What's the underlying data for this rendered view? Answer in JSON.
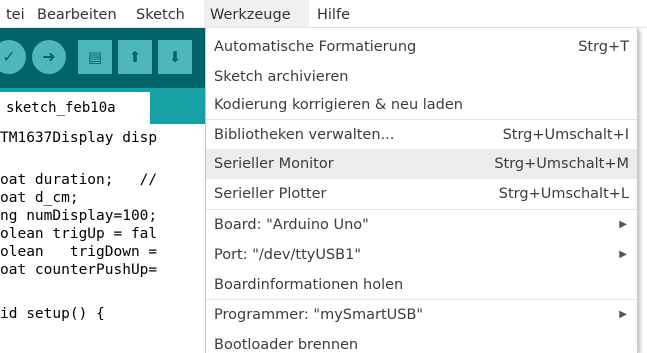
{
  "menubar": {
    "items": [
      {
        "label": "tei"
      },
      {
        "label": "Bearbeiten"
      },
      {
        "label": "Sketch"
      },
      {
        "label": "Werkzeuge"
      },
      {
        "label": "Hilfe"
      }
    ]
  },
  "toolbar": {
    "verify_icon": "verify-icon",
    "upload_icon": "upload-icon",
    "new_icon": "new-icon",
    "open_icon": "open-icon",
    "save_icon": "save-icon"
  },
  "editor": {
    "tab_label": "sketch_feb10a",
    "lines": [
      "TM1637Display disp",
      "",
      "oat duration;   //",
      "oat d_cm;",
      "ng numDisplay=100;",
      "olean trigUp = fal",
      "olean   trigDown =",
      "oat counterPushUp=",
      "",
      "id setup() {"
    ]
  },
  "dropdown": {
    "items": [
      {
        "label": "Automatische Formatierung",
        "shortcut": "Strg+T"
      },
      {
        "label": "Sketch archivieren",
        "shortcut": ""
      },
      {
        "label": "Kodierung korrigieren & neu laden",
        "shortcut": ""
      },
      {
        "label": "Bibliotheken verwalten...",
        "shortcut": "Strg+Umschalt+I"
      },
      {
        "label": "Serieller Monitor",
        "shortcut": "Strg+Umschalt+M"
      },
      {
        "label": "Serieller Plotter",
        "shortcut": "Strg+Umschalt+L"
      },
      {
        "label": "Board: \"Arduino Uno\"",
        "shortcut": ""
      },
      {
        "label": "Port: \"/dev/ttyUSB1\"",
        "shortcut": ""
      },
      {
        "label": "Boardinformationen holen",
        "shortcut": ""
      },
      {
        "label": "Programmer: \"mySmartUSB\"",
        "shortcut": ""
      },
      {
        "label": "Bootloader brennen",
        "shortcut": ""
      }
    ],
    "highlighted_item": "Serieller Monitor"
  },
  "colors": {
    "toolbar_bg": "#006468",
    "tab_strip_bg": "#17a1a5",
    "button_bg": "#4db7bb",
    "keyword": "#00979c",
    "highlight": "#ececec"
  }
}
